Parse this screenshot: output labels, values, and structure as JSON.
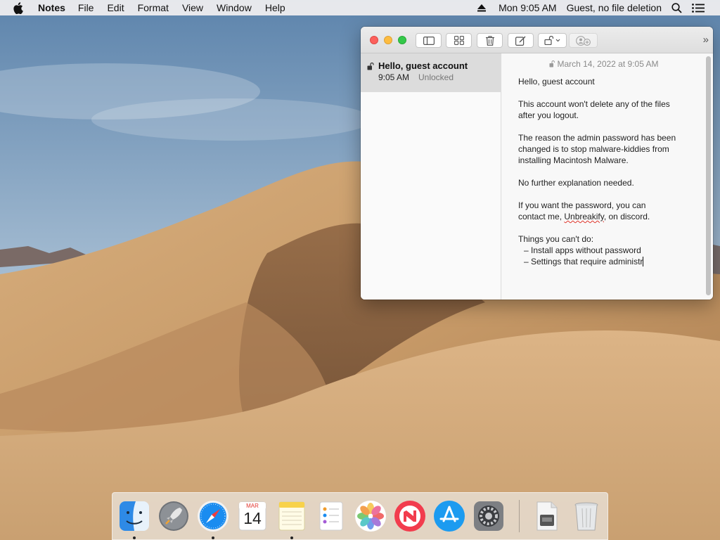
{
  "menubar": {
    "apple_icon": "apple-logo",
    "app_name": "Notes",
    "menus": [
      "File",
      "Edit",
      "Format",
      "View",
      "Window",
      "Help"
    ],
    "clock": "Mon 9:05 AM",
    "user": "Guest, no file deletion",
    "status_icons": [
      "eject-icon",
      "spotlight-search-icon",
      "notification-center-icon"
    ]
  },
  "notes_window": {
    "toolbar_icons": [
      "sidebar-toggle-icon",
      "gallery-view-icon",
      "trash-icon",
      "compose-icon",
      "lock-icon",
      "share-add-people-icon",
      "expand-icon"
    ],
    "expand_glyph": "»",
    "note_list": [
      {
        "title": "Hello, guest account",
        "time": "9:05 AM",
        "status": "Unlocked"
      }
    ],
    "editor": {
      "date": "March 14, 2022 at 9:05 AM",
      "lines": {
        "l1": "Hello, guest account",
        "l2a": "This account won't delete any of the files",
        "l2b": "after you logout.",
        "l3a": "The reason the admin password has been",
        "l3b": "changed is to stop malware-kiddies from",
        "l3c": "installing Macintosh Malware.",
        "l4": "No further explanation needed.",
        "l5a": "If you want the password, you can",
        "l5b_pre": "contact me, ",
        "l5b_name": "Unbreakify",
        "l5b_post": ", on discord.",
        "l6": "Things you can't do:",
        "b1": "–  Install apps without password",
        "b2": "–  Settings that require administr"
      }
    }
  },
  "dock": {
    "apps": [
      "Finder",
      "Launchpad",
      "Safari",
      "Calendar",
      "Notes",
      "Reminders",
      "Photos",
      "News",
      "App Store",
      "System Preferences",
      "Downloads",
      "Trash"
    ],
    "calendar_month": "MAR",
    "calendar_day": "14",
    "colors": {
      "finder": "#2e8ae6",
      "safari": "#1a8cf0",
      "news": "#f23c4d",
      "appstore": "#1c9bf0"
    }
  }
}
